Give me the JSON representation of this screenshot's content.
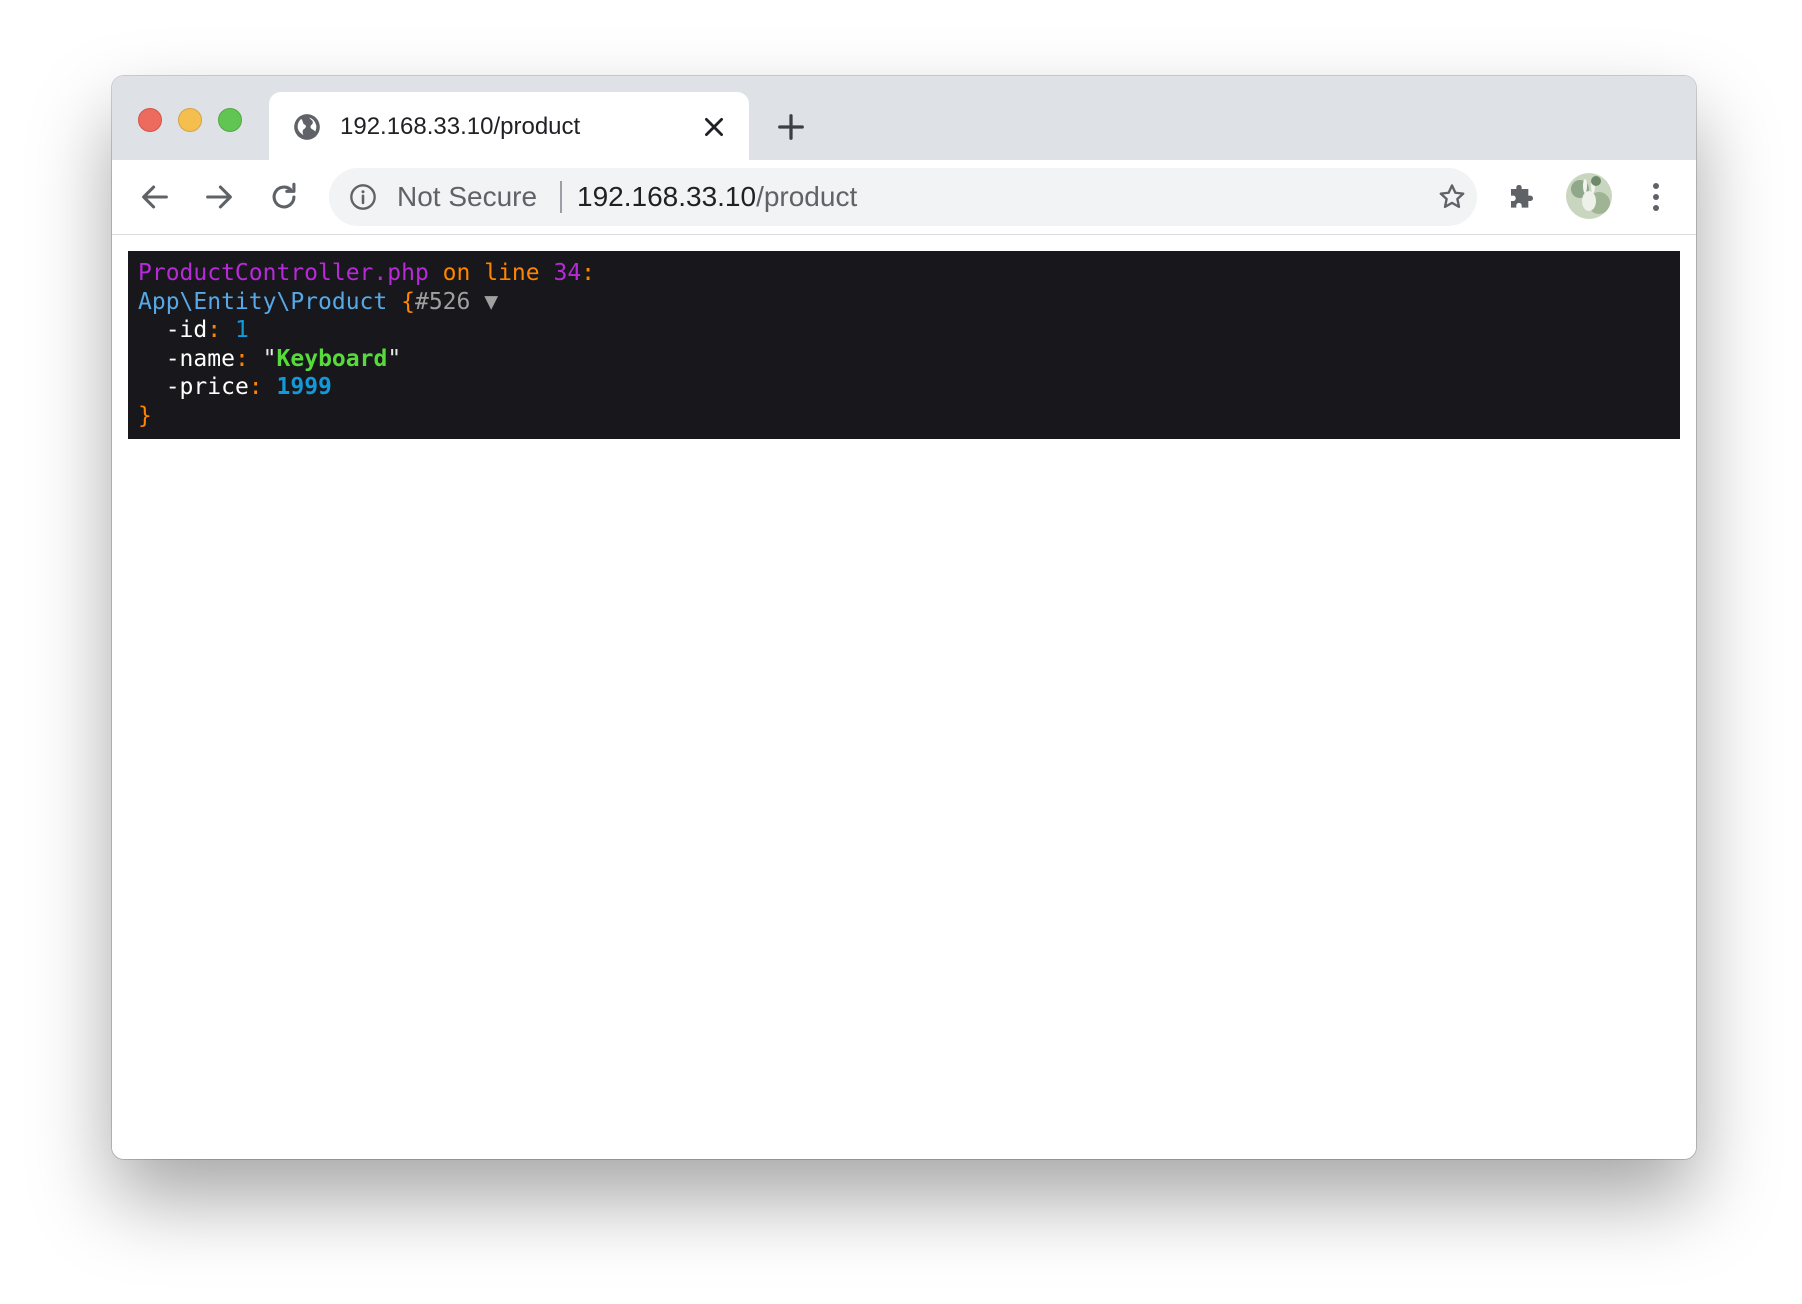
{
  "browser": {
    "tab": {
      "title": "192.168.33.10/product",
      "favicon": "globe-icon"
    },
    "new_tab_icon": "plus-icon",
    "toolbar": {
      "back_icon": "arrow-left-icon",
      "forward_icon": "arrow-right-icon",
      "reload_icon": "reload-icon",
      "security_label": "Not Secure",
      "url_host": "192.168.33.10",
      "url_path": "/product",
      "bookmark_icon": "star-icon",
      "extensions_icon": "puzzle-icon",
      "menu_icon": "kebab-menu-icon"
    },
    "colors": {
      "tabstrip_bg": "#dee1e6",
      "omnibox_bg": "#f1f3f4",
      "traffic_red": "#ed6a5e",
      "traffic_yellow": "#f5bf4f",
      "traffic_green": "#61c554"
    }
  },
  "dump": {
    "file": "ProductController.php",
    "on_text": "on",
    "line_text": "line",
    "line_number": "34",
    "colon": ":",
    "class_name": "App\\Entity\\Product",
    "open_brace": "{",
    "object_id": "#526",
    "toggle": "▼",
    "properties": [
      {
        "name": "-id",
        "sep": ":",
        "value": "1"
      },
      {
        "name": "-name",
        "sep": ":",
        "quote_open": "\"",
        "value": "Keyboard",
        "quote_close": "\""
      },
      {
        "name": "-price",
        "sep": ":",
        "value": "1999"
      }
    ],
    "close_brace": "}",
    "colors": {
      "background": "#18171b",
      "file": "#b729d9",
      "keyword": "#ff8400",
      "class": "#56a9e6",
      "number": "#1299da",
      "string": "#56db3a"
    }
  }
}
